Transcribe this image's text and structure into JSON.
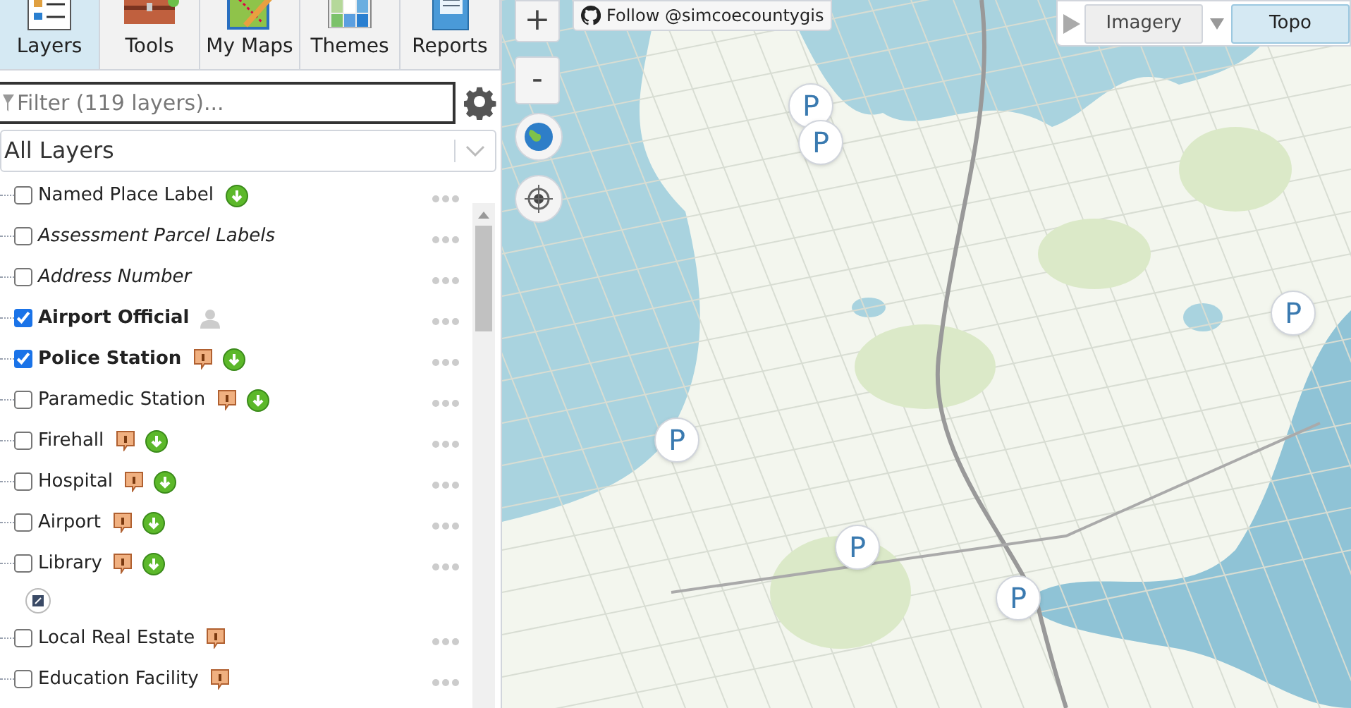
{
  "tabs": [
    {
      "label": "Layers",
      "selected": true,
      "badge": false
    },
    {
      "label": "Tools",
      "selected": false,
      "badge": true
    },
    {
      "label": "My Maps",
      "selected": false,
      "badge": false
    },
    {
      "label": "Themes",
      "selected": false,
      "badge": false
    },
    {
      "label": "Reports",
      "selected": false,
      "badge": false
    }
  ],
  "filter": {
    "placeholder": "Filter (119 layers)..."
  },
  "group_select": {
    "value": "All Layers"
  },
  "layers": [
    {
      "name": "Named Place Label",
      "checked": false,
      "bold": false,
      "italic": false,
      "info_icon": false,
      "download_icon": true,
      "user_icon": false
    },
    {
      "name": "Assessment Parcel Labels",
      "checked": false,
      "bold": false,
      "italic": true,
      "info_icon": false,
      "download_icon": false,
      "user_icon": false
    },
    {
      "name": "Address Number",
      "checked": false,
      "bold": false,
      "italic": true,
      "info_icon": false,
      "download_icon": false,
      "user_icon": false
    },
    {
      "name": "Airport Official",
      "checked": true,
      "bold": true,
      "italic": false,
      "info_icon": false,
      "download_icon": false,
      "user_icon": true
    },
    {
      "name": "Police Station",
      "checked": true,
      "bold": true,
      "italic": false,
      "info_icon": true,
      "download_icon": true,
      "user_icon": false
    },
    {
      "name": "Paramedic Station",
      "checked": false,
      "bold": false,
      "italic": false,
      "info_icon": true,
      "download_icon": true,
      "user_icon": false
    },
    {
      "name": "Firehall",
      "checked": false,
      "bold": false,
      "italic": false,
      "info_icon": true,
      "download_icon": true,
      "user_icon": false
    },
    {
      "name": "Hospital",
      "checked": false,
      "bold": false,
      "italic": false,
      "info_icon": true,
      "download_icon": true,
      "user_icon": false
    },
    {
      "name": "Airport",
      "checked": false,
      "bold": false,
      "italic": false,
      "info_icon": true,
      "download_icon": true,
      "user_icon": false
    },
    {
      "name": "Library",
      "checked": false,
      "bold": false,
      "italic": false,
      "info_icon": true,
      "download_icon": true,
      "user_icon": false,
      "extra_icon": true
    },
    {
      "name": "Local Real Estate",
      "checked": false,
      "bold": false,
      "italic": false,
      "info_icon": true,
      "download_icon": false,
      "user_icon": false
    },
    {
      "name": "Education Facility",
      "checked": false,
      "bold": false,
      "italic": false,
      "info_icon": true,
      "download_icon": false,
      "user_icon": false
    }
  ],
  "map": {
    "follow_button": "Follow @simcoecountygis",
    "zoom_in": "+",
    "zoom_out": "-",
    "basemaps": [
      {
        "label": "Imagery",
        "selected": false
      },
      {
        "label": "Topo",
        "selected": true
      }
    ],
    "markers": [
      "P",
      "P",
      "P",
      "P",
      "P",
      "P"
    ]
  }
}
